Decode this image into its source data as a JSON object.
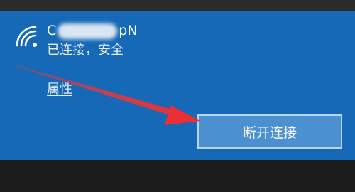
{
  "network": {
    "name_visible_start": "C",
    "name_visible_end": "pN",
    "status": "已连接，安全",
    "properties_label": "属性",
    "disconnect_label": "断开连接"
  },
  "colors": {
    "panel": "#1569b7",
    "button": "#4b90d1",
    "annotation_arrow": "#e8373c"
  },
  "icons": {
    "network": "wifi-icon",
    "annotation": "red-arrow-annotation"
  }
}
